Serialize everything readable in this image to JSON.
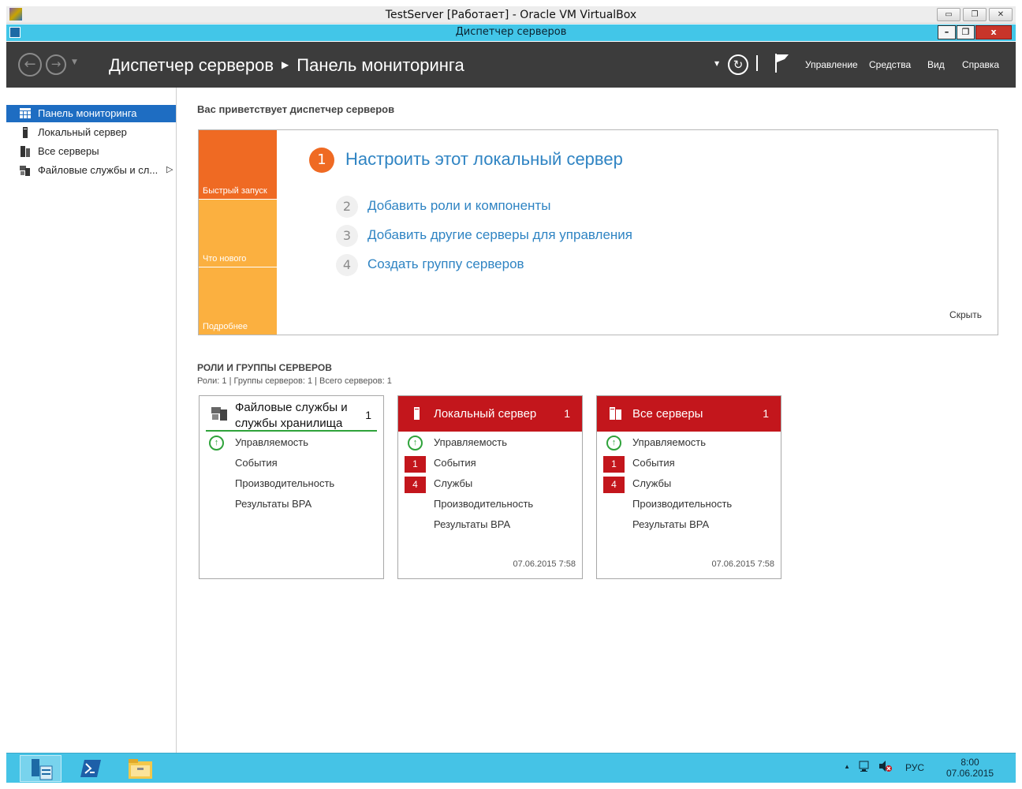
{
  "vbox": {
    "title": "TestServer [Работает] - Oracle VM VirtualBox"
  },
  "window": {
    "title": "Диспетчер серверов"
  },
  "header": {
    "breadcrumb_root": "Диспетчер серверов",
    "breadcrumb_page": "Панель мониторинга",
    "menus": [
      "Управление",
      "Средства",
      "Вид",
      "Справка"
    ]
  },
  "sidebar": {
    "items": [
      {
        "label": "Панель мониторинга",
        "icon": "dashboard-icon",
        "active": true
      },
      {
        "label": "Локальный сервер",
        "icon": "server-icon"
      },
      {
        "label": "Все серверы",
        "icon": "servers-icon"
      },
      {
        "label": "Файловые службы и сл...",
        "icon": "file-services-icon"
      }
    ]
  },
  "welcome": {
    "title": "Вас приветствует диспетчер серверов"
  },
  "quickstart": {
    "tiles": [
      "Быстрый запуск",
      "Что нового",
      "Подробнее"
    ],
    "step1": {
      "number": "1",
      "text": "Настроить этот локальный сервер"
    },
    "steps": [
      {
        "number": "2",
        "text": "Добавить роли и компоненты"
      },
      {
        "number": "3",
        "text": "Добавить другие серверы для управления"
      },
      {
        "number": "4",
        "text": "Создать группу серверов"
      }
    ],
    "hide": "Скрыть"
  },
  "roles": {
    "title": "РОЛИ И ГРУППЫ СЕРВЕРОВ",
    "subtitle": "Роли: 1 | Группы серверов: 1 | Всего серверов: 1",
    "cards": [
      {
        "title_line1": "Файловые службы и",
        "title_line2": "службы хранилища",
        "count": "1",
        "rows": [
          {
            "label": "Управляемость",
            "status": "ok"
          },
          {
            "label": "События"
          },
          {
            "label": "Производительность"
          },
          {
            "label": "Результаты BPA"
          }
        ]
      },
      {
        "title": "Локальный сервер",
        "count": "1",
        "rows": [
          {
            "label": "Управляемость",
            "status": "ok"
          },
          {
            "label": "События",
            "badge": "1"
          },
          {
            "label": "Службы",
            "badge": "4"
          },
          {
            "label": "Производительность"
          },
          {
            "label": "Результаты BPA"
          }
        ],
        "timestamp": "07.06.2015 7:58"
      },
      {
        "title": "Все серверы",
        "count": "1",
        "rows": [
          {
            "label": "Управляемость",
            "status": "ok"
          },
          {
            "label": "События",
            "badge": "1"
          },
          {
            "label": "Службы",
            "badge": "4"
          },
          {
            "label": "Производительность"
          },
          {
            "label": "Результаты BPA"
          }
        ],
        "timestamp": "07.06.2015 7:58"
      }
    ]
  },
  "taskbar": {
    "apps": [
      "server-manager-icon",
      "powershell-icon",
      "file-explorer-icon"
    ],
    "lang": "РУС",
    "time": "8:00",
    "date": "07.06.2015"
  },
  "colors": {
    "accent_blue": "#1e6dc2",
    "tile_orange": "#ef6a23",
    "tile_amber": "#fbb040",
    "alert_red": "#c3161c",
    "ok_green": "#2fa33b",
    "taskbar": "#45c3e6"
  }
}
